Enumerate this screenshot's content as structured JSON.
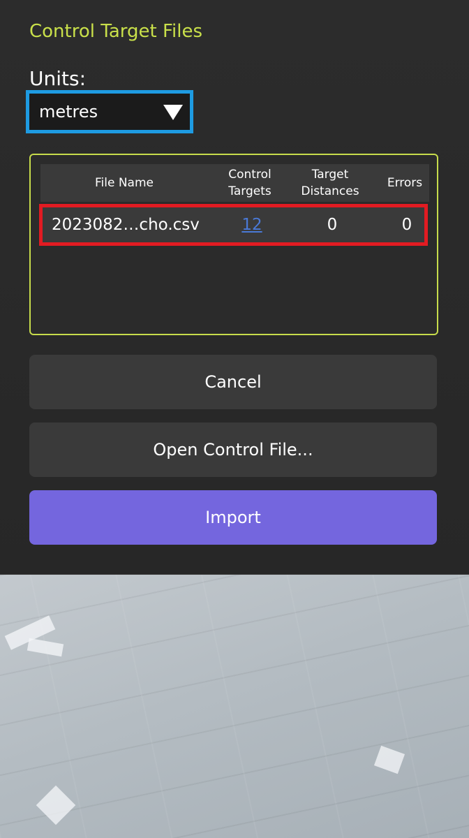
{
  "dialog": {
    "title": "Control Target Files",
    "units_label": "Units:",
    "units_value": "metres"
  },
  "table": {
    "headers": {
      "file_name": "File Name",
      "control_targets": [
        "Control",
        "Targets"
      ],
      "target_distances": [
        "Target",
        "Distances"
      ],
      "errors": "Errors"
    },
    "rows": [
      {
        "file_name": "2023082…cho.csv",
        "control_targets": "12",
        "target_distances": "0",
        "errors": "0"
      }
    ]
  },
  "buttons": {
    "cancel": "Cancel",
    "open_control_file": "Open Control File...",
    "import": "Import"
  },
  "colors": {
    "title": "#c9e04a",
    "units_highlight": "#1e9be2",
    "row_highlight": "#e21b22",
    "box_border": "#c7dc4b",
    "import_button": "#7466de",
    "link": "#4a79d6"
  }
}
